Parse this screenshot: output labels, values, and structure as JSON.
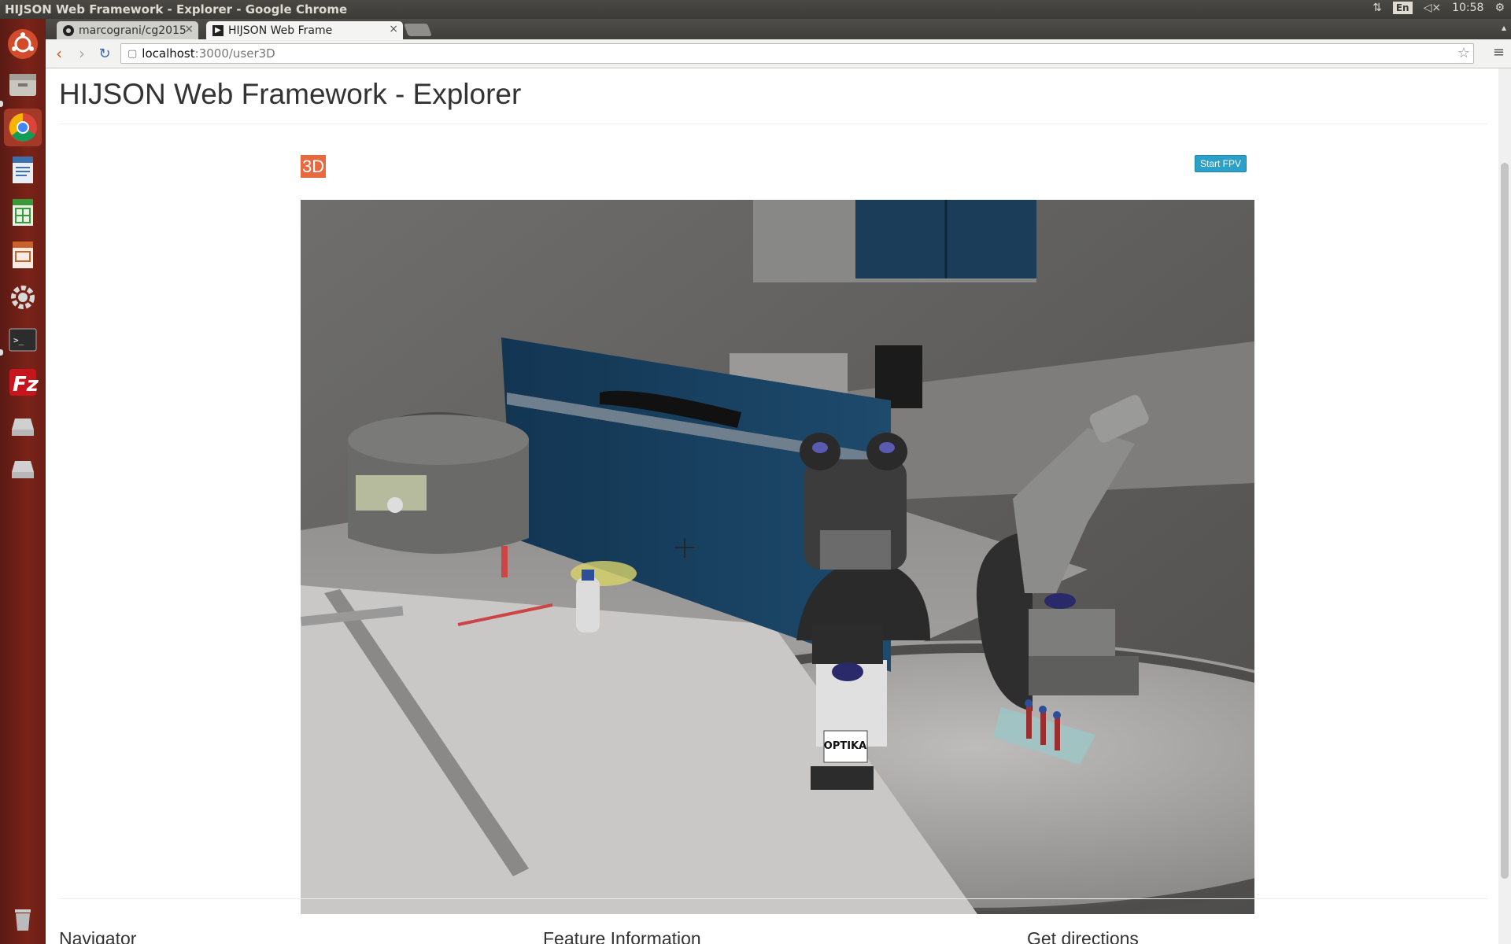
{
  "os": {
    "window_title": "HIJSON Web Framework - Explorer - Google Chrome",
    "keyboard_layout": "En",
    "clock": "10:58",
    "launcher_icons": [
      "ubuntu-dash-icon",
      "files-icon",
      "chrome-icon",
      "writer-icon",
      "calc-icon",
      "impress-icon",
      "settings-icon",
      "terminal-icon",
      "filezilla-icon",
      "drive-icon",
      "drive-icon",
      "trash-icon"
    ]
  },
  "browser": {
    "tabs": [
      {
        "label": "marcograni/cg2015",
        "active": false
      },
      {
        "label": "HIJSON Web Frame",
        "active": true
      }
    ],
    "url_host": "localhost",
    "url_path": ":3000/user3D"
  },
  "page": {
    "title": "HIJSON Web Framework - Explorer",
    "badge": "3D",
    "start_fpv_label": "Start FPV",
    "sections": [
      "Navigator",
      "Feature Information",
      "Get directions"
    ],
    "scene_label": "OPTIKA"
  },
  "colors": {
    "badge": "#e8693f",
    "fpv_button": "#2ba0c8",
    "launcher": "#7a2318"
  }
}
